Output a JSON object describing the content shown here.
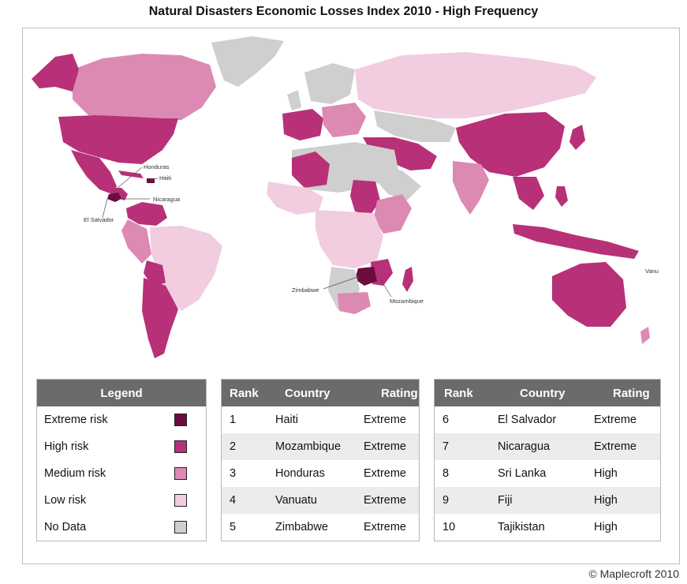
{
  "title": "Natural Disasters Economic Losses Index 2010 - High Frequency",
  "copyright": "© Maplecroft 2010",
  "colors": {
    "extreme": "#6d0c3f",
    "high": "#b83078",
    "medium": "#dc8ab3",
    "low": "#f1cddf",
    "nodata": "#cfcfcf"
  },
  "map_labels": {
    "honduras": "Honduras",
    "haiti": "Haiti",
    "nicaragua": "Nicaragua",
    "el_salvador": "El Salvador",
    "zimbabwe": "Zimbabwe",
    "mozambique": "Mozambique",
    "vanuatu": "Vanu"
  },
  "legend": {
    "header": "Legend",
    "items": [
      {
        "label": "Extreme risk",
        "color": "#6d0c3f"
      },
      {
        "label": "High risk",
        "color": "#b83078"
      },
      {
        "label": "Medium risk",
        "color": "#dc8ab3"
      },
      {
        "label": "Low risk",
        "color": "#f1cddf"
      },
      {
        "label": "No Data",
        "color": "#cfcfcf"
      }
    ]
  },
  "table_headers": {
    "rank": "Rank",
    "country": "Country",
    "rating": "Rating"
  },
  "rankings_left": [
    {
      "rank": "1",
      "country": "Haiti",
      "rating": "Extreme"
    },
    {
      "rank": "2",
      "country": "Mozambique",
      "rating": "Extreme"
    },
    {
      "rank": "3",
      "country": "Honduras",
      "rating": "Extreme"
    },
    {
      "rank": "4",
      "country": "Vanuatu",
      "rating": "Extreme"
    },
    {
      "rank": "5",
      "country": "Zimbabwe",
      "rating": "Extreme"
    }
  ],
  "rankings_right": [
    {
      "rank": "6",
      "country": "El Salvador",
      "rating": "Extreme"
    },
    {
      "rank": "7",
      "country": "Nicaragua",
      "rating": "Extreme"
    },
    {
      "rank": "8",
      "country": "Sri Lanka",
      "rating": "High"
    },
    {
      "rank": "9",
      "country": "Fiji",
      "rating": "High"
    },
    {
      "rank": "10",
      "country": "Tajikistan",
      "rating": "High"
    }
  ]
}
